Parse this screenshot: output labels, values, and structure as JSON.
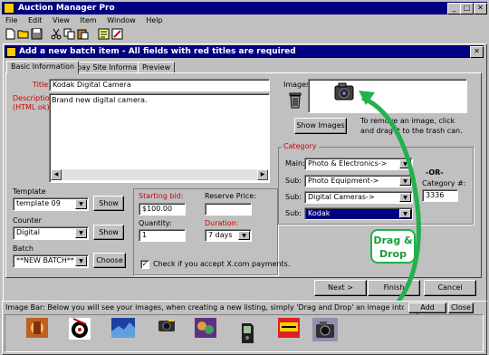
{
  "app": {
    "title": "Auction Manager Pro"
  },
  "menu": [
    "File",
    "Edit",
    "View",
    "Item",
    "Window",
    "Help"
  ],
  "dialog": {
    "title": "Add a new batch item - All fields with red titles are required"
  },
  "tabs": [
    "Basic Information",
    "Ebay Site Information",
    "Preview"
  ],
  "form": {
    "title_label": "Title",
    "title_value": "Kodak Digital Camera",
    "description_label": "Description",
    "description_note": "(HTML ok)",
    "description_value": "Brand new digital camera.",
    "template_label": "Template",
    "template_value": "template 09",
    "counter_label": "Counter",
    "counter_value": "Digital",
    "batch_label": "Batch",
    "batch_value": "**NEW BATCH**",
    "show_label": "Show",
    "choose_label": "Choose",
    "starting_bid_label": "Starting bid:",
    "starting_bid_value": "$100.00",
    "reserve_label": "Reserve Price:",
    "reserve_value": "",
    "quantity_label": "Quantity:",
    "quantity_value": "1",
    "duration_label": "Duration:",
    "duration_value": "7 days",
    "xcom_label": "Check if you accept X.com payments.",
    "xcom_checked": true
  },
  "images": {
    "label": "Images:",
    "show_button": "Show Images",
    "hint": "To remove an image, click and drag it to the trash can."
  },
  "category": {
    "label": "Category",
    "main_label": "Main:",
    "sub_label": "Sub:",
    "main_value": "Photo & Electronics->",
    "sub1_value": "Photo Equipment->",
    "sub2_value": "Digital Cameras->",
    "sub3_value": "Kodak",
    "or_label": "-OR-",
    "number_label": "Category #:",
    "number_value": "3336"
  },
  "footer": {
    "next": "Next >",
    "finish": "Finish",
    "cancel": "Cancel"
  },
  "callout": {
    "line1": "Drag &",
    "line2": "Drop"
  },
  "image_bar": {
    "text": "Image Bar:  Below you will see your images, when creating a new listing, simply 'Drag and Drop' an image into your new listing",
    "add_image": "Add Image",
    "close": "Close"
  },
  "colors": {
    "titlebar": "#000080",
    "window_bg": "#c0c0c0",
    "required_red": "#d00000",
    "arrow_green": "#22b14c",
    "selection": "#000080"
  }
}
